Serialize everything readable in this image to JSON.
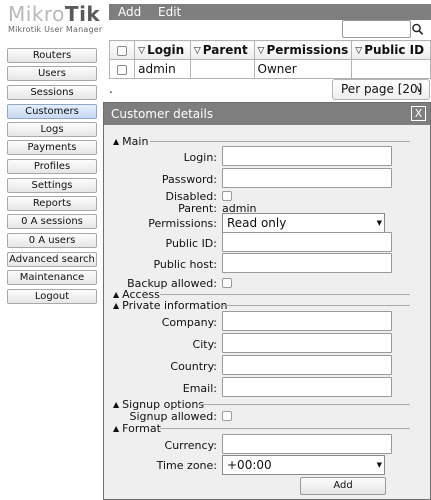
{
  "logo": {
    "brand_light": "Mikro",
    "brand_bold": "Tik",
    "subtitle": "Mikrotik User Manager"
  },
  "nav": [
    "Routers",
    "Users",
    "Sessions",
    "Customers",
    "Logs",
    "Payments",
    "Profiles",
    "Settings",
    "Reports",
    "0 A sessions",
    "0 A users",
    "Advanced search",
    "Maintenance",
    "Logout"
  ],
  "active_nav": "Customers",
  "toolbar": {
    "add": "Add",
    "edit": "Edit"
  },
  "table": {
    "columns": [
      "Login",
      "Parent",
      "Permissions",
      "Public ID"
    ],
    "rows": [
      {
        "login": "admin",
        "parent": "",
        "permissions": "Owner",
        "public_id": ""
      }
    ]
  },
  "list_footer": {
    "dot": ".",
    "per_page": "Per page [20]"
  },
  "dialog": {
    "title": "Customer details",
    "close": "X",
    "sections": {
      "main": "Main",
      "access": "Access",
      "private": "Private information",
      "signup": "Signup options",
      "format": "Format"
    },
    "labels": {
      "login": "Login:",
      "password": "Password:",
      "disabled": "Disabled:",
      "parent": "Parent:",
      "permissions": "Permissions:",
      "public_id": "Public ID:",
      "public_host": "Public host:",
      "backup_allowed": "Backup allowed:",
      "company": "Company:",
      "city": "City:",
      "country": "Country:",
      "email": "Email:",
      "signup_allowed": "Signup allowed:",
      "currency": "Currency:",
      "time_zone": "Time zone:"
    },
    "values": {
      "parent": "admin",
      "permissions": "Read only",
      "time_zone": "+00:00"
    },
    "add_button": "Add"
  }
}
